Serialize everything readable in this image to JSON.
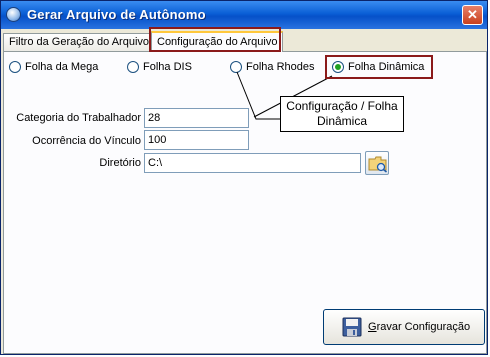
{
  "window": {
    "title": "Gerar Arquivo de Autônomo"
  },
  "tabs": [
    {
      "label": "Filtro da Geração do Arquivo",
      "active": false
    },
    {
      "label": "Configuração do Arquivo",
      "active": true
    }
  ],
  "radios": [
    {
      "label": "Folha da Mega",
      "checked": false
    },
    {
      "label": "Folha DIS",
      "checked": false
    },
    {
      "label": "Folha Rhodes",
      "checked": false
    },
    {
      "label": "Folha Dinâmica",
      "checked": true
    }
  ],
  "callout": {
    "line1": "Configuração / Folha",
    "line2": "Dinâmica"
  },
  "fields": {
    "categoria": {
      "label": "Categoria do Trabalhador",
      "value": "28"
    },
    "ocorrencia": {
      "label": "Ocorrência do Vínculo",
      "value": "100"
    },
    "diretorio": {
      "label": "Diretório",
      "value": "C:\\"
    }
  },
  "save_button": {
    "mnemonic": "G",
    "rest": "ravar Configuração"
  },
  "icons": {
    "app": "app-icon",
    "close": "close-icon",
    "folder_browse": "folder-search-icon",
    "save": "floppy-disk-icon"
  },
  "colors": {
    "title_bar": "#0a5fd6",
    "annotation": "#8b1a1a",
    "radio_checked": "#21a121"
  }
}
